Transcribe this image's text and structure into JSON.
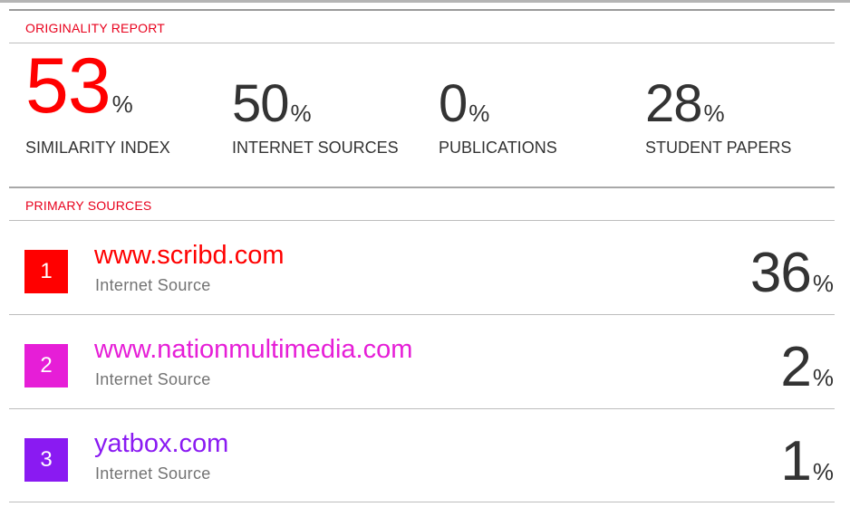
{
  "report": {
    "originality_heading": "ORIGINALITY REPORT",
    "primary_heading": "PRIMARY SOURCES"
  },
  "metrics": [
    {
      "value": "53",
      "unit": "%",
      "label": "SIMILARITY INDEX"
    },
    {
      "value": "50",
      "unit": "%",
      "label": "INTERNET SOURCES"
    },
    {
      "value": "0",
      "unit": "%",
      "label": "PUBLICATIONS"
    },
    {
      "value": "28",
      "unit": "%",
      "label": "STUDENT PAPERS"
    }
  ],
  "sources": [
    {
      "rank": "1",
      "title": "www.scribd.com",
      "type": "Internet Source",
      "value": "36",
      "unit": "%",
      "color": "#ff0000"
    },
    {
      "rank": "2",
      "title": "www.nationmultimedia.com",
      "type": "Internet Source",
      "value": "2",
      "unit": "%",
      "color": "#e61ed7"
    },
    {
      "rank": "3",
      "title": "yatbox.com",
      "type": "Internet Source",
      "value": "1",
      "unit": "%",
      "color": "#8a1af2"
    }
  ]
}
